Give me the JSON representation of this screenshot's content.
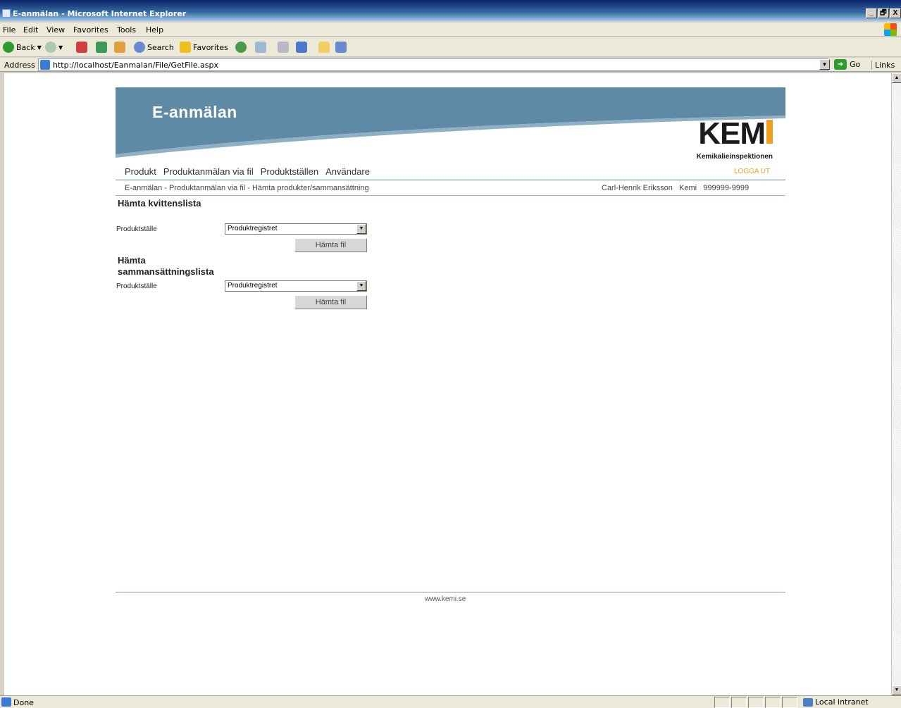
{
  "window": {
    "title": "E-anmälan - Microsoft Internet Explorer",
    "buttons": [
      "_",
      "🗗",
      "X"
    ]
  },
  "menu": [
    "File",
    "Edit",
    "View",
    "Favorites",
    "Tools",
    "Help"
  ],
  "toolbar": {
    "back": "Back",
    "search": "Search",
    "favorites": "Favorites"
  },
  "address": {
    "label": "Address",
    "url": "http://localhost/Eanmalan/File/GetFile.aspx",
    "go": "Go",
    "links": "Links"
  },
  "page": {
    "site_title": "E-anmälan",
    "logo_text": "KEM",
    "logo_sub": "Kemikalieinspektionen",
    "nav": [
      "Produkt",
      "Produktanmälan via fil",
      "Produktställen",
      "Användare"
    ],
    "logout": "LOGGA UT",
    "breadcrumb": "E-anmälan - Produktanmälan via fil - Hämta produkter/sammansättning",
    "user_info": "Carl-Henrik Eriksson   Kemi   999999-9999",
    "sections": [
      {
        "title": "Hämta kvittenslista",
        "field_label": "Produktställe",
        "selected": "Produktregistret",
        "button": "Hämta fil"
      },
      {
        "title": "Hämta sammansättningslista",
        "field_label": "Produktställe",
        "selected": "Produktregistret",
        "button": "Hämta fil"
      }
    ],
    "footer": "www.kemi.se"
  },
  "status": {
    "text": "Done",
    "zone": "Local intranet"
  },
  "colors": {
    "banner": "#5f8aa6",
    "logo_accent": "#f0a020",
    "logout": "#f0a020"
  }
}
